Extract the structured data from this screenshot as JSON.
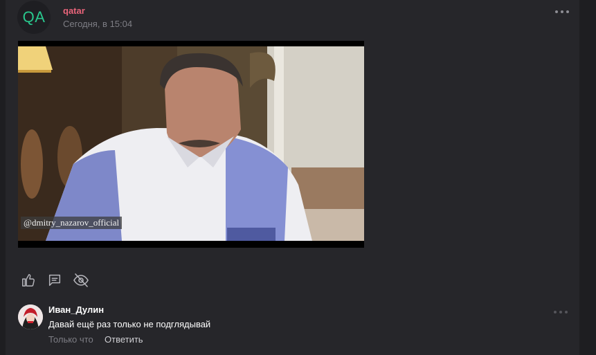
{
  "post": {
    "avatar_initials": "QA",
    "author": "qatar",
    "time": "Сегодня, в 15:04",
    "video": {
      "watermark": "@dmitry_nazarov_official"
    },
    "actions": [
      {
        "icon": "thumbs-up-icon"
      },
      {
        "icon": "comment-icon"
      },
      {
        "icon": "eye-off-icon"
      }
    ]
  },
  "comment": {
    "author": "Иван_Дулин",
    "text": "Давай ещё раз только не подглядывай",
    "time": "Только что",
    "reply_label": "Ответить"
  },
  "colors": {
    "page_bg": "#1e1e21",
    "card_bg": "#26262a",
    "author_accent": "#e9647a",
    "initials_accent": "#29c78d",
    "muted": "#7e7e85"
  }
}
